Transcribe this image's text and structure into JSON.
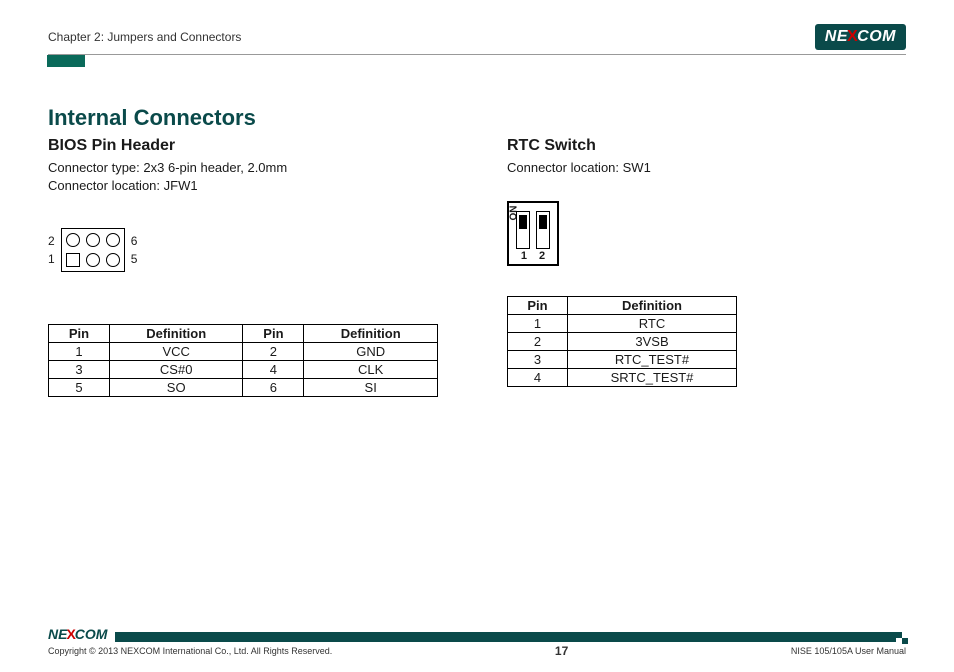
{
  "header": {
    "chapter": "Chapter 2: Jumpers and Connectors",
    "brand_pre": "NE",
    "brand_x": "X",
    "brand_post": "COM"
  },
  "page": {
    "heading": "Internal Connectors"
  },
  "bios": {
    "title": "BIOS Pin Header",
    "line1": "Connector type: 2x3 6-pin header, 2.0mm",
    "line2": "Connector location: JFW1",
    "labels": {
      "tl": "2",
      "tr": "6",
      "bl": "1",
      "br": "5"
    },
    "th_pin": "Pin",
    "th_def": "Definition",
    "rows": [
      {
        "p1": "1",
        "d1": "VCC",
        "p2": "2",
        "d2": "GND"
      },
      {
        "p1": "3",
        "d1": "CS#0",
        "p2": "4",
        "d2": "CLK"
      },
      {
        "p1": "5",
        "d1": "SO",
        "p2": "6",
        "d2": "SI"
      }
    ]
  },
  "rtc": {
    "title": "RTC Switch",
    "line1": "Connector location: SW1",
    "on_label": "ON",
    "num1": "1",
    "num2": "2",
    "th_pin": "Pin",
    "th_def": "Definition",
    "rows": [
      {
        "p": "1",
        "d": "RTC"
      },
      {
        "p": "2",
        "d": "3VSB"
      },
      {
        "p": "3",
        "d": "RTC_TEST#"
      },
      {
        "p": "4",
        "d": "SRTC_TEST#"
      }
    ]
  },
  "footer": {
    "brand_pre": "NE",
    "brand_x": "X",
    "brand_post": "COM",
    "copyright": "Copyright © 2013 NEXCOM International Co., Ltd. All Rights Reserved.",
    "page_num": "17",
    "manual": "NISE 105/105A User Manual"
  }
}
